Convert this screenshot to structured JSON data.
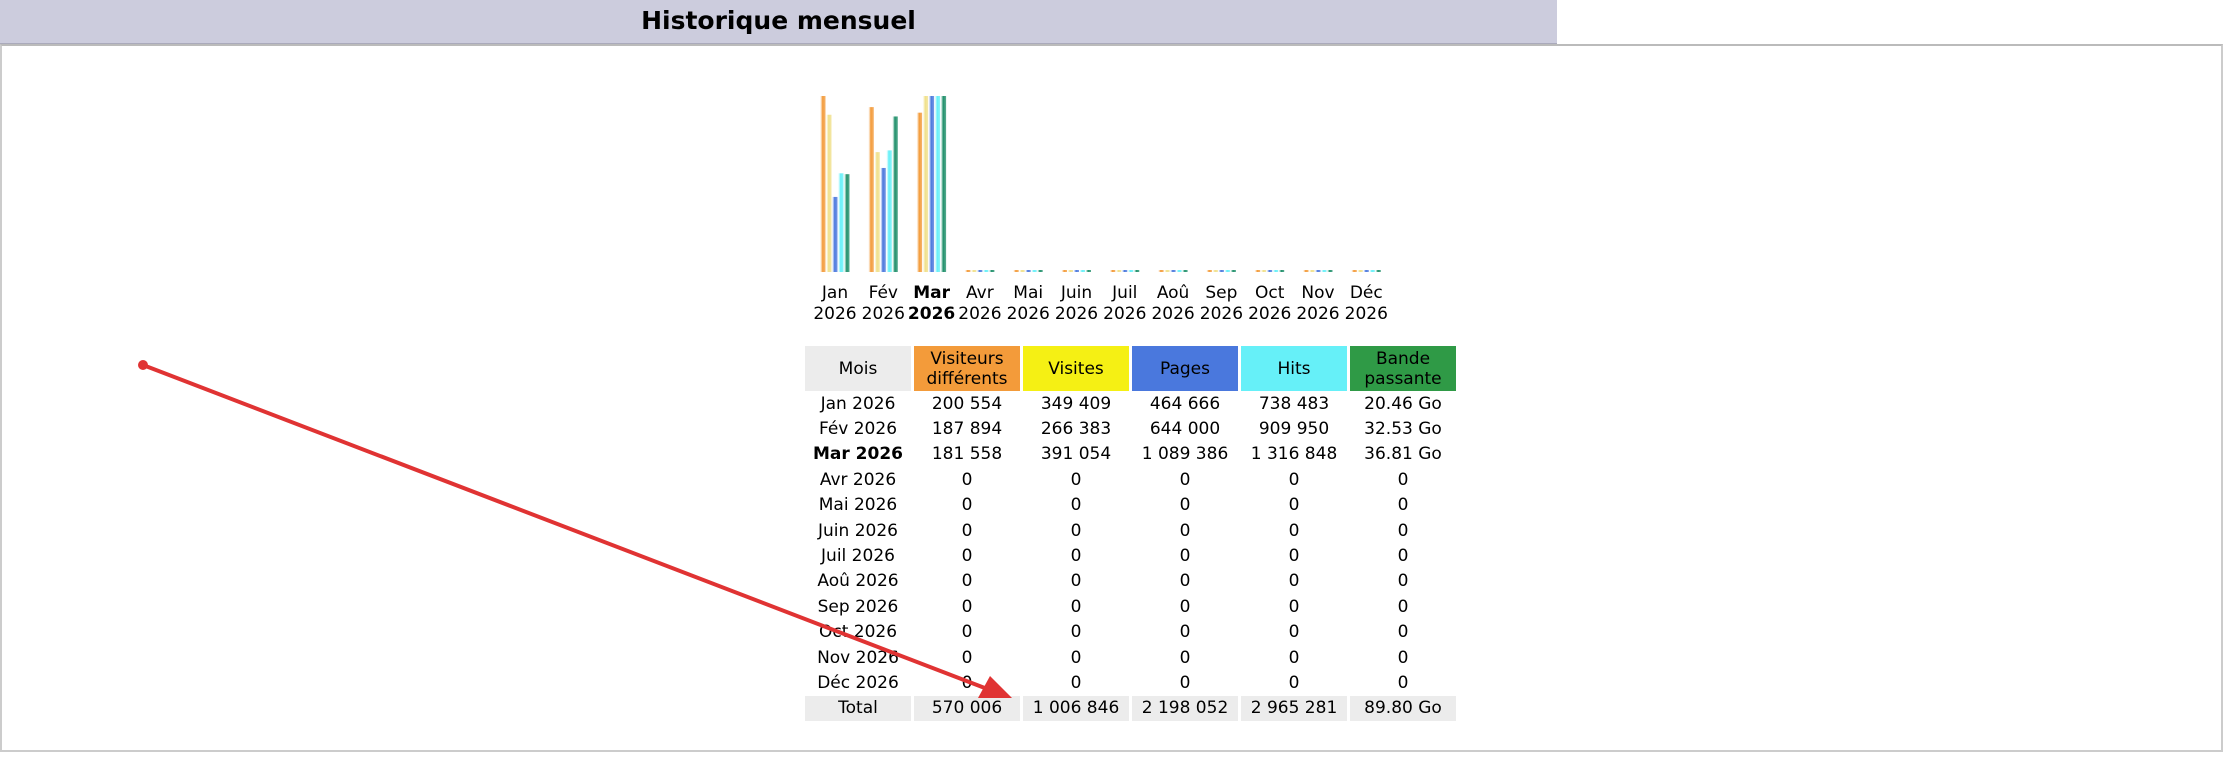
{
  "header": {
    "title": "Historique mensuel"
  },
  "colors": {
    "visitors": "#f39b3a",
    "visits": "#f5f014",
    "pages": "#4a78dd",
    "hits": "#66f0f8",
    "bandwidth": "#2f9a46",
    "annotation_arrow": "#e03333"
  },
  "chart_data": {
    "type": "bar",
    "categories": [
      [
        "Jan",
        "2026"
      ],
      [
        "Fév",
        "2026"
      ],
      [
        "Mar",
        "2026"
      ],
      [
        "Avr",
        "2026"
      ],
      [
        "Mai",
        "2026"
      ],
      [
        "Juin",
        "2026"
      ],
      [
        "Juil",
        "2026"
      ],
      [
        "Aoû",
        "2026"
      ],
      [
        "Sep",
        "2026"
      ],
      [
        "Oct",
        "2026"
      ],
      [
        "Nov",
        "2026"
      ],
      [
        "Déc",
        "2026"
      ]
    ],
    "current_index": 2,
    "series": [
      {
        "name": "Visiteurs différents",
        "color": "#f39b3a",
        "values": [
          200554,
          187894,
          181558,
          0,
          0,
          0,
          0,
          0,
          0,
          0,
          0,
          0
        ]
      },
      {
        "name": "Visites",
        "color": "#f0e08a",
        "values": [
          349409,
          266383,
          391054,
          0,
          0,
          0,
          0,
          0,
          0,
          0,
          0,
          0
        ]
      },
      {
        "name": "Pages",
        "color": "#4a78dd",
        "values": [
          464666,
          644000,
          1089386,
          0,
          0,
          0,
          0,
          0,
          0,
          0,
          0,
          0
        ]
      },
      {
        "name": "Hits",
        "color": "#66f0f8",
        "values": [
          738483,
          909950,
          1316848,
          0,
          0,
          0,
          0,
          0,
          0,
          0,
          0,
          0
        ]
      },
      {
        "name": "Bande passante",
        "color": "#1f8f6a",
        "values": [
          20.46,
          32.53,
          36.81,
          0,
          0,
          0,
          0,
          0,
          0,
          0,
          0,
          0
        ]
      }
    ]
  },
  "table": {
    "headers": [
      "Mois",
      "Visiteurs différents",
      "Visites",
      "Pages",
      "Hits",
      "Bande passante"
    ],
    "header_lines": [
      [
        "Mois"
      ],
      [
        "Visiteurs",
        "différents"
      ],
      [
        "Visites"
      ],
      [
        "Pages"
      ],
      [
        "Hits"
      ],
      [
        "Bande",
        "passante"
      ]
    ],
    "rows": [
      [
        "Jan 2026",
        "200 554",
        "349 409",
        "464 666",
        "738 483",
        "20.46 Go"
      ],
      [
        "Fév 2026",
        "187 894",
        "266 383",
        "644 000",
        "909 950",
        "32.53 Go"
      ],
      [
        "Mar 2026",
        "181 558",
        "391 054",
        "1 089 386",
        "1 316 848",
        "36.81 Go"
      ],
      [
        "Avr 2026",
        "0",
        "0",
        "0",
        "0",
        "0"
      ],
      [
        "Mai 2026",
        "0",
        "0",
        "0",
        "0",
        "0"
      ],
      [
        "Juin 2026",
        "0",
        "0",
        "0",
        "0",
        "0"
      ],
      [
        "Juil 2026",
        "0",
        "0",
        "0",
        "0",
        "0"
      ],
      [
        "Aoû 2026",
        "0",
        "0",
        "0",
        "0",
        "0"
      ],
      [
        "Sep 2026",
        "0",
        "0",
        "0",
        "0",
        "0"
      ],
      [
        "Oct 2026",
        "0",
        "0",
        "0",
        "0",
        "0"
      ],
      [
        "Nov 2026",
        "0",
        "0",
        "0",
        "0",
        "0"
      ],
      [
        "Déc 2026",
        "0",
        "0",
        "0",
        "0",
        "0"
      ]
    ],
    "current_row": 2,
    "total": [
      "Total",
      "570 006",
      "1 006 846",
      "2 198 052",
      "2 965 281",
      "89.80 Go"
    ]
  }
}
